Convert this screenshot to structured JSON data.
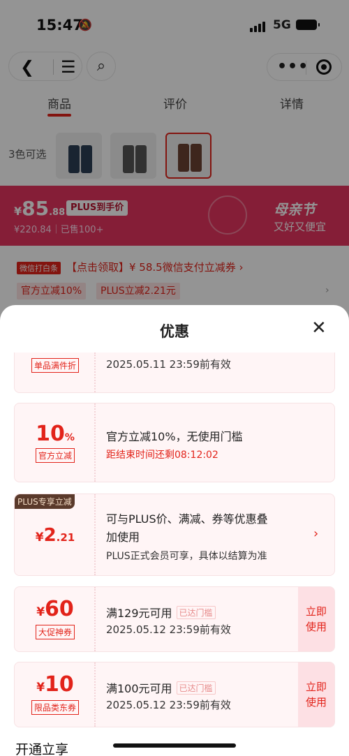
{
  "status": {
    "time": "15:47",
    "network": "5G"
  },
  "tabs": [
    "商品",
    "评价",
    "详情"
  ],
  "colors_label": "3色可选",
  "price": {
    "currency": "¥",
    "integer": "85",
    "decimal": ".88",
    "plus_tag": "PLUS到手价",
    "original": "¥220.84｜已售100+",
    "festival_title": "母亲节",
    "festival_sub": "又好又便宜"
  },
  "coupon_row": {
    "tag": "微信打白条",
    "text": "【点击领取】¥ 58.5微信支付立减券 ›"
  },
  "chips": [
    "官方立减10%",
    "PLUS立减2.21元"
  ],
  "sheet": {
    "title": "优惠",
    "cards": [
      {
        "tag": "单品满件折",
        "line1": "2025.05.11 23:59前有效"
      },
      {
        "amount": "10",
        "suffix": "%",
        "tag": "官方立减",
        "line1": "官方立减10%，无使用门槛",
        "line2": "距结束时间还剩08:12:02"
      },
      {
        "badge": "PLUS专享立减",
        "currency": "¥",
        "amount": "2",
        "decimal": ".21",
        "line1": "可与PLUS价、满减、券等优惠叠",
        "line2": "加使用",
        "line3": "PLUS正式会员可享，具体以结算为准",
        "arrow": "›"
      },
      {
        "currency": "¥",
        "amount": "60",
        "tag": "大促神券",
        "line1": "满129元可用",
        "reach": "已达门槛",
        "line2": "2025.05.12 23:59前有效",
        "use": "立即使用"
      },
      {
        "currency": "¥",
        "amount": "10",
        "tag": "限品类东券",
        "line1": "满100元可用",
        "reach": "已达门槛",
        "line2": "2025.05.12 23:59前有效",
        "use": "立即使用"
      }
    ],
    "bottom_title": "开通立享"
  }
}
